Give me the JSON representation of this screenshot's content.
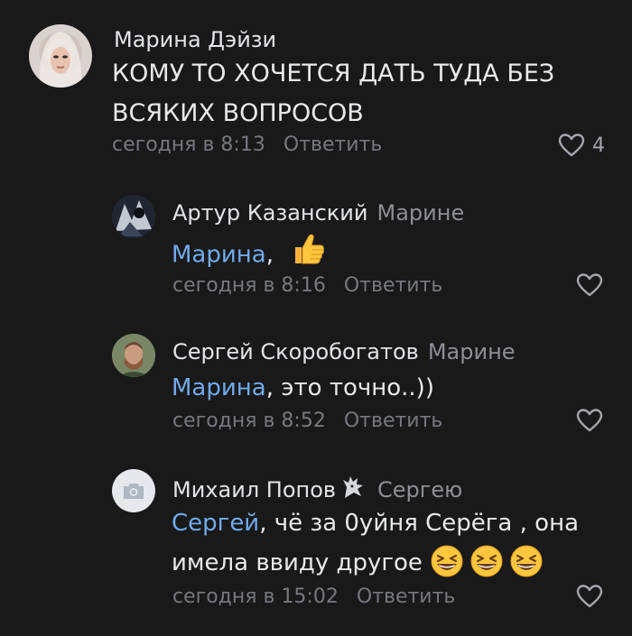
{
  "comments": [
    {
      "author": "Марина Дэйзи",
      "text": "КОМУ ТО ХОЧЕТСЯ ДАТЬ ТУДА БЕЗ ВСЯКИХ ВОПРОСОВ",
      "time": "сегодня в 8:13",
      "reply_label": "Ответить",
      "likes": "4"
    },
    {
      "author": "Артур Казанский",
      "reply_to": "Марине",
      "mention": "Марина",
      "text": ",",
      "emoji": "thumbs-up",
      "time": "сегодня в 8:16",
      "reply_label": "Ответить"
    },
    {
      "author": "Сергей Скоробогатов",
      "reply_to": "Марине",
      "mention": "Марина",
      "text": ", это точно..))",
      "time": "сегодня в 8:52",
      "reply_label": "Ответить"
    },
    {
      "author": "Михаил Попов",
      "reply_to": "Сергею",
      "mention": "Сергей",
      "text_line1": ", чё за 0уйня Серёга , она",
      "text_line2": "имела ввиду другое",
      "emoji": "grinning-squinting-face",
      "time": "сегодня в 15:02",
      "reply_label": "Ответить"
    }
  ],
  "colors": {
    "background": "#19191a",
    "mention": "#71aaeb",
    "meta": "#76787d"
  }
}
